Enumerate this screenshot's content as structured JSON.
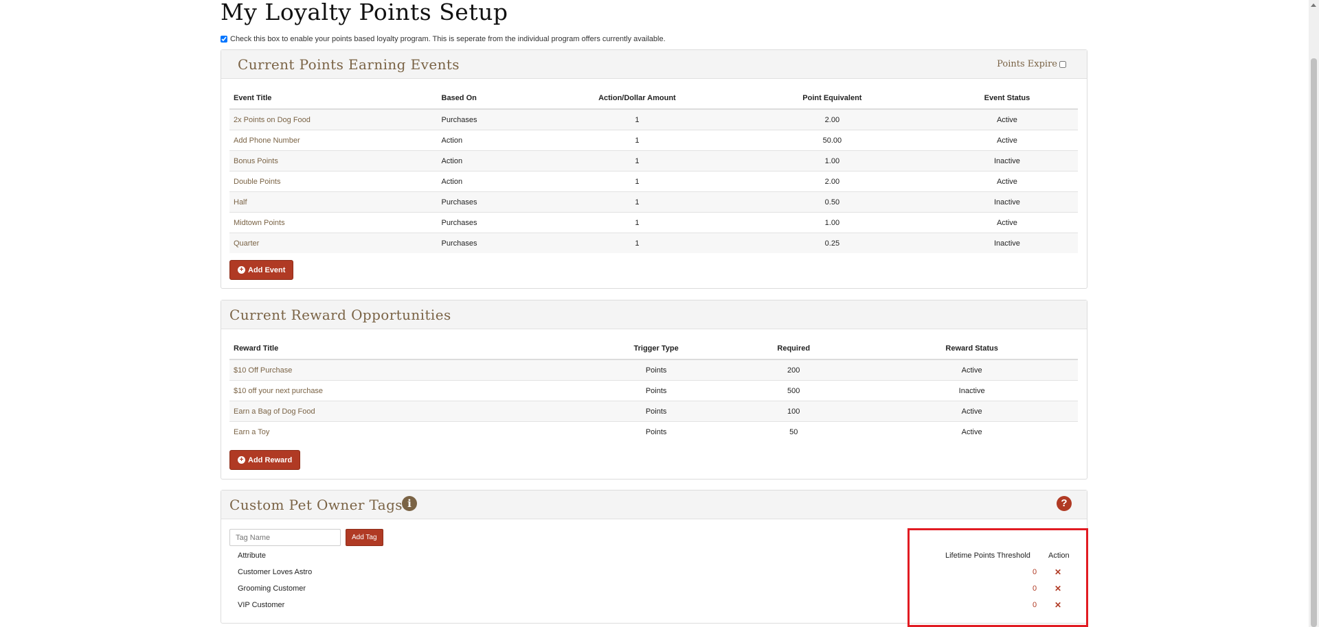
{
  "page_title": "My Loyalty Points Setup",
  "enable_program": {
    "checked": true,
    "label": "Check this box to enable your points based loyalty program. This is seperate from the individual program offers currently available."
  },
  "events": {
    "title": "Current Points Earning Events",
    "points_expire_label": "Points Expire",
    "columns": [
      "Event Title",
      "Based On",
      "Action/Dollar Amount",
      "Point Equivalent",
      "Event Status"
    ],
    "rows": [
      [
        "2x Points on Dog Food",
        "Purchases",
        "1",
        "2.00",
        "Active"
      ],
      [
        "Add Phone Number",
        "Action",
        "1",
        "50.00",
        "Active"
      ],
      [
        "Bonus Points",
        "Action",
        "1",
        "1.00",
        "Inactive"
      ],
      [
        "Double Points",
        "Action",
        "1",
        "2.00",
        "Active"
      ],
      [
        "Half",
        "Purchases",
        "1",
        "0.50",
        "Inactive"
      ],
      [
        "Midtown Points",
        "Purchases",
        "1",
        "1.00",
        "Active"
      ],
      [
        "Quarter",
        "Purchases",
        "1",
        "0.25",
        "Inactive"
      ]
    ],
    "add_button": "Add Event"
  },
  "rewards": {
    "title": "Current Reward Opportunities",
    "columns": [
      "Reward Title",
      "Trigger Type",
      "Required",
      "Reward Status"
    ],
    "rows": [
      [
        "$10 Off Purchase",
        "Points",
        "200",
        "Active"
      ],
      [
        "$10 off your next purchase",
        "Points",
        "500",
        "Inactive"
      ],
      [
        "Earn a Bag of Dog Food",
        "Points",
        "100",
        "Active"
      ],
      [
        "Earn a Toy",
        "Points",
        "50",
        "Active"
      ]
    ],
    "add_button": "Add Reward"
  },
  "tags": {
    "title": "Custom Pet Owner Tags",
    "input_placeholder": "Tag Name",
    "add_button": "Add Tag",
    "attribute_header": "Attribute",
    "threshold_header": "Lifetime Points Threshold",
    "action_header": "Action",
    "rows": [
      {
        "name": "Customer Loves Astro",
        "threshold": "0"
      },
      {
        "name": "Grooming Customer",
        "threshold": "0"
      },
      {
        "name": "VIP Customer",
        "threshold": "0"
      }
    ]
  },
  "icons": {
    "info": "info-icon",
    "help": "help-icon",
    "delete": "close-icon",
    "add": "plus-circle-icon"
  },
  "colors": {
    "accent": "#b03a24",
    "link": "#7a6345",
    "highlight": "#e11b22"
  }
}
